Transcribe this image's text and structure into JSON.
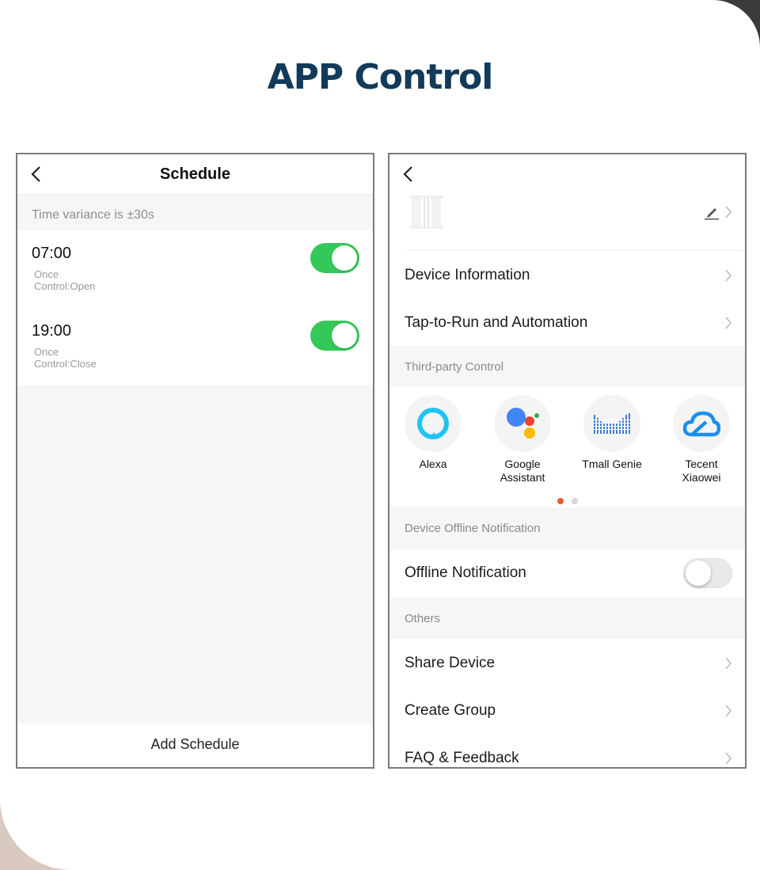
{
  "headline": "APP Control",
  "colors": {
    "headline": "#123a5a",
    "toggle_on": "#34c759",
    "dot_active": "#f05a28",
    "dot_inactive": "#d8d8d8"
  },
  "schedule_screen": {
    "title": "Schedule",
    "variance_note": "Time variance is  ±30s",
    "items": [
      {
        "time": "07:00",
        "repeat": "Once",
        "control": "Control:Open",
        "enabled": true
      },
      {
        "time": "19:00",
        "repeat": "Once",
        "control": "Control:Close",
        "enabled": true
      }
    ],
    "add_button": "Add Schedule"
  },
  "settings_screen": {
    "menu_top": [
      {
        "label": "Device Information"
      },
      {
        "label": "Tap-to-Run and Automation"
      }
    ],
    "third_party_header": "Third-party Control",
    "third_party": [
      {
        "name": "Alexa",
        "icon": "alexa-icon"
      },
      {
        "name": "Google\nAssistant",
        "icon": "google-assistant-icon"
      },
      {
        "name": "Tmall Genie",
        "icon": "tmall-genie-icon"
      },
      {
        "name": "Tecent\nXiaowei",
        "icon": "tencent-xiaowei-icon"
      }
    ],
    "page_indicator": {
      "current": 1,
      "total": 2
    },
    "offline_header": "Device Offline Notification",
    "offline_label": "Offline Notification",
    "offline_enabled": false,
    "others_header": "Others",
    "menu_others": [
      {
        "label": "Share Device"
      },
      {
        "label": "Create Group"
      },
      {
        "label": "FAQ & Feedback"
      }
    ]
  }
}
